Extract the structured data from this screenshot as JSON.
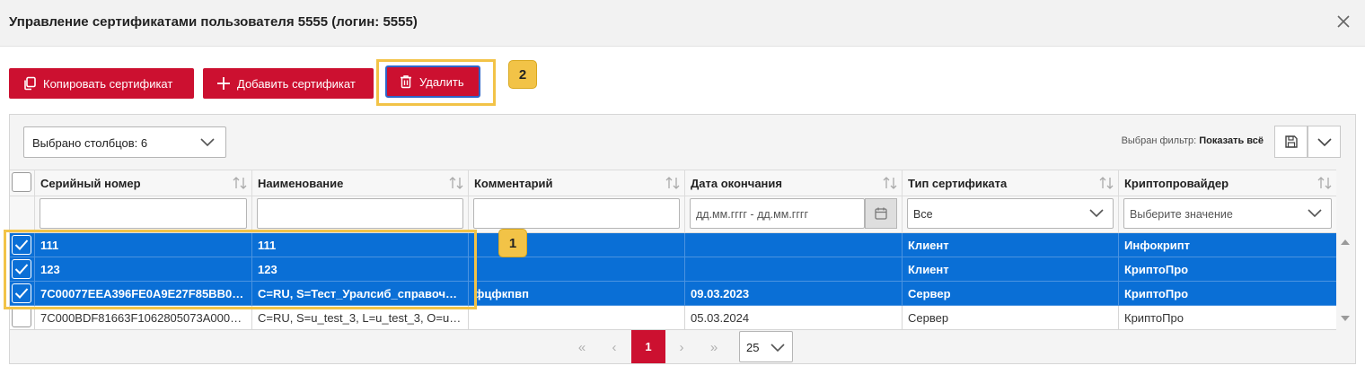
{
  "dialog": {
    "title": "Управление сертификатами пользователя 5555 (логин: 5555)"
  },
  "toolbar": {
    "copy_label": "Копировать сертификат",
    "add_label": "Добавить сертификат",
    "delete_label": "Удалить"
  },
  "markers": {
    "rows": "1",
    "delete": "2"
  },
  "grid_controls": {
    "columns_selected": "Выбрано столбцов: 6",
    "filter_label": "Выбран фильтр:",
    "filter_value": "Показать всё"
  },
  "columns": [
    {
      "label": "Серийный номер"
    },
    {
      "label": "Наименование"
    },
    {
      "label": "Комментарий"
    },
    {
      "label": "Дата окончания"
    },
    {
      "label": "Тип сертификата"
    },
    {
      "label": "Криптопровайдер"
    }
  ],
  "filters": {
    "serial": "",
    "name": "",
    "comment": "",
    "date_placeholder": "дд.мм.гггг - дд.мм.гггг",
    "type_value": "Все",
    "crypto_placeholder": "Выберите значение"
  },
  "rows": [
    {
      "selected": true,
      "serial": "111",
      "name": "111",
      "comment": "",
      "date": "",
      "type": "Клиент",
      "crypto": "Инфокрипт"
    },
    {
      "selected": true,
      "serial": "123",
      "name": "123",
      "comment": "",
      "date": "",
      "type": "Клиент",
      "crypto": "КриптоПро"
    },
    {
      "selected": true,
      "serial": "7C00077EEA396FE0A9E27F85BB000...",
      "name": "C=RU, S=Тест_Уралсиб_справочни...",
      "comment": "фцфкпвп",
      "date": "09.03.2023",
      "type": "Сервер",
      "crypto": "КриптоПро"
    },
    {
      "selected": false,
      "serial": "7C000BDF81663F1062805073A0000...",
      "name": "C=RU, S=u_test_3, L=u_test_3, O=u_...",
      "comment": "",
      "date": "05.03.2024",
      "type": "Сервер",
      "crypto": "КриптоПро"
    }
  ],
  "pager": {
    "first": "«",
    "prev": "‹",
    "current_page": "1",
    "next": "›",
    "last": "»",
    "per_page": "25"
  },
  "colors": {
    "accent_red": "#cc1030",
    "selection_blue": "#0a6fd6",
    "highlight_yellow": "#f2c347"
  },
  "icons": [
    "copy-icon",
    "plus-icon",
    "trash-icon",
    "close-icon",
    "chevron-down-icon",
    "sort-icon",
    "calendar-icon",
    "save-icon",
    "check-icon"
  ]
}
